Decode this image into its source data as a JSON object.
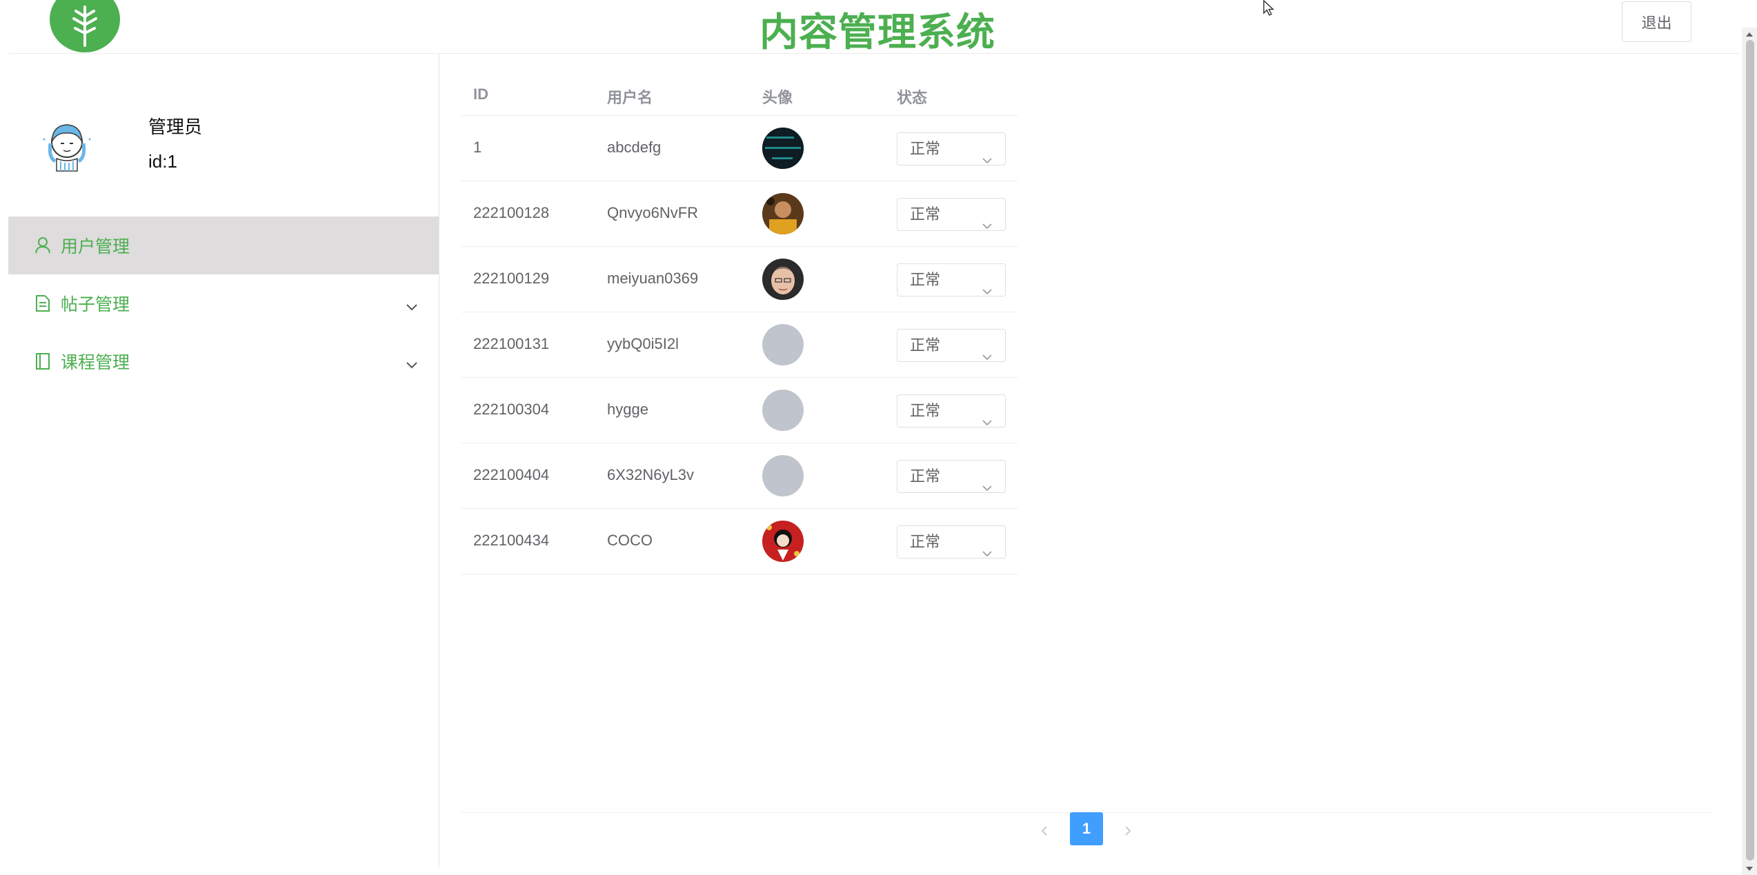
{
  "header": {
    "title": "内容管理系统",
    "logout_label": "退出"
  },
  "profile": {
    "name": "管理员",
    "id_text": "id:1"
  },
  "sidebar": {
    "items": [
      {
        "label": "用户管理",
        "icon": "user-icon",
        "active": true,
        "expandable": false
      },
      {
        "label": "帖子管理",
        "icon": "document-icon",
        "active": false,
        "expandable": true
      },
      {
        "label": "课程管理",
        "icon": "notebook-icon",
        "active": false,
        "expandable": true
      }
    ]
  },
  "table": {
    "headers": {
      "id": "ID",
      "username": "用户名",
      "avatar": "头像",
      "status": "状态"
    },
    "rows": [
      {
        "id": "1",
        "username": "abcdefg",
        "avatar": "code-screenshot-avatar",
        "status": "正常"
      },
      {
        "id": "222100128",
        "username": "Qnvyo6NvFR",
        "avatar": "photo-avatar",
        "status": "正常"
      },
      {
        "id": "222100129",
        "username": "meiyuan0369",
        "avatar": "face-photo-avatar",
        "status": "正常"
      },
      {
        "id": "222100131",
        "username": "yybQ0i5I2l",
        "avatar": "default-avatar",
        "status": "正常"
      },
      {
        "id": "222100304",
        "username": "hygge",
        "avatar": "default-avatar",
        "status": "正常"
      },
      {
        "id": "222100404",
        "username": "6X32N6yL3v",
        "avatar": "default-avatar",
        "status": "正常"
      },
      {
        "id": "222100434",
        "username": "COCO",
        "avatar": "anime-red-avatar",
        "status": "正常"
      }
    ]
  },
  "pagination": {
    "current_page": "1"
  },
  "colors": {
    "brand_green": "#4caf50",
    "active_menu_bg": "#dedcdc",
    "page_blue": "#409eff",
    "default_avatar": "#c0c4cc"
  }
}
